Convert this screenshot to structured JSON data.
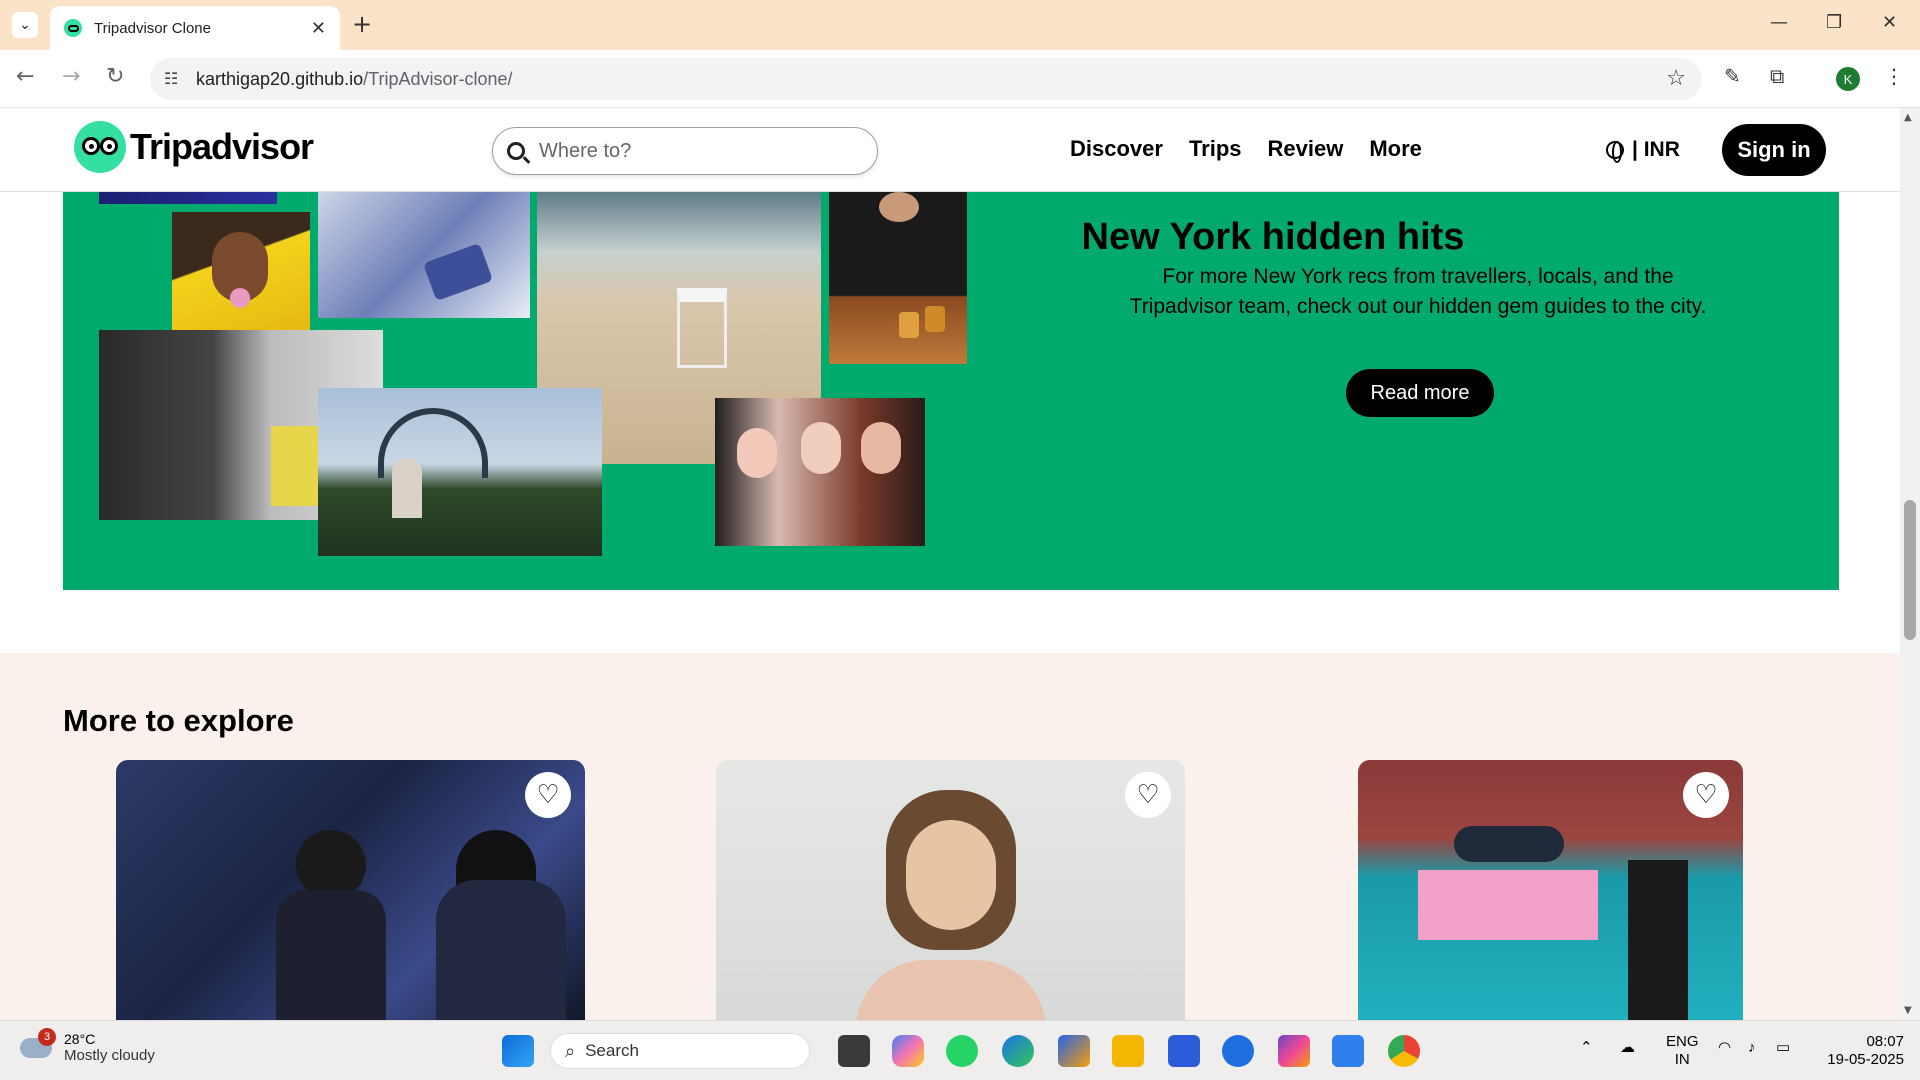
{
  "browser": {
    "tab_title": "Tripadvisor Clone",
    "url_host": "karthigap20.github.io",
    "url_path": "/TripAdvisor-clone/",
    "profile_initial": "K"
  },
  "header": {
    "logo_text": "Tripadvisor",
    "search_placeholder": "Where to?",
    "nav": [
      "Discover",
      "Trips",
      "Review",
      "More"
    ],
    "currency": "| INR",
    "signin_label": "Sign in"
  },
  "promo": {
    "title": "New York hidden hits",
    "text": "For more New York recs from travellers, locals, and the Tripadvisor team, check out our hidden gem guides to the city.",
    "button_label": "Read more",
    "bg_color": "#00aa6c"
  },
  "explore": {
    "title": "More to explore",
    "cards": [
      {
        "image": "live-music-band-photo"
      },
      {
        "image": "smiling-woman-portrait-photo"
      },
      {
        "image": "dessert-shop-storefront-photo"
      }
    ]
  },
  "taskbar": {
    "weather_temp": "28°C",
    "weather_desc": "Mostly cloudy",
    "weather_badge": "3",
    "search_label": "Search",
    "lang_top": "ENG",
    "lang_bottom": "IN",
    "time": "08:07",
    "date": "19-05-2025"
  }
}
